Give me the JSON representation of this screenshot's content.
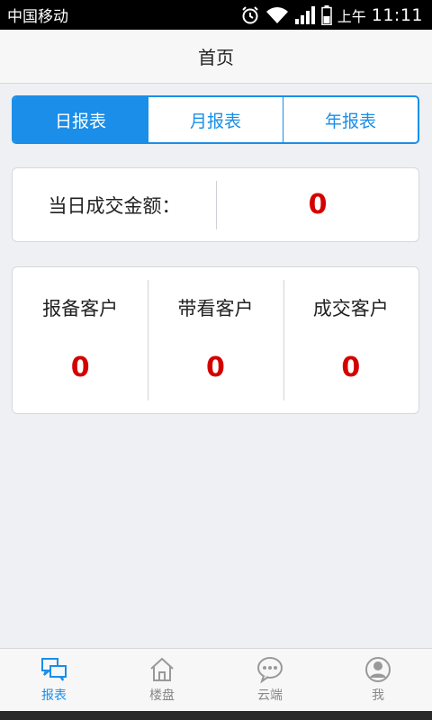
{
  "status_bar": {
    "carrier": "中国移动",
    "ampm": "上午",
    "time": "11:11",
    "icons": [
      "alarm-icon",
      "wifi-icon",
      "signal-icon",
      "battery-icon"
    ]
  },
  "header": {
    "title": "首页"
  },
  "tabs": [
    {
      "label": "日报表",
      "active": true
    },
    {
      "label": "月报表",
      "active": false
    },
    {
      "label": "年报表",
      "active": false
    }
  ],
  "daily_amount": {
    "label": "当日成交金额：",
    "value": "0"
  },
  "clients": [
    {
      "label": "报备客户",
      "value": "0"
    },
    {
      "label": "带看客户",
      "value": "0"
    },
    {
      "label": "成交客户",
      "value": "0"
    }
  ],
  "bottom_nav": [
    {
      "label": "报表",
      "icon": "report-icon",
      "active": true
    },
    {
      "label": "楼盘",
      "icon": "home-icon",
      "active": false
    },
    {
      "label": "云端",
      "icon": "chat-icon",
      "active": false
    },
    {
      "label": "我",
      "icon": "user-icon",
      "active": false
    }
  ],
  "colors": {
    "accent": "#1a8ee8",
    "value_red": "#d40000",
    "background": "#eef0f3"
  }
}
